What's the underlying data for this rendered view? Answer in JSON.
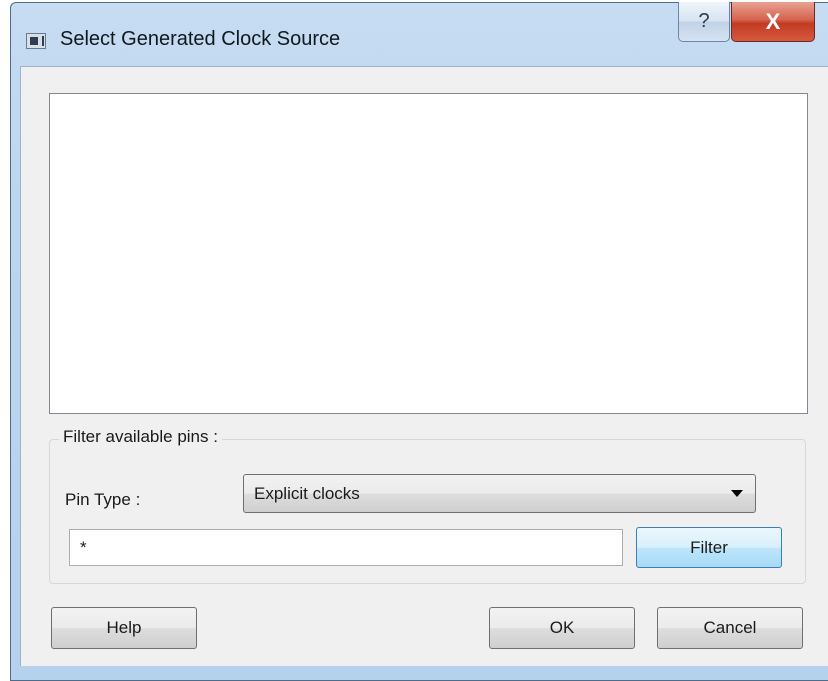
{
  "window": {
    "title": "Select Generated Clock Source",
    "help_glyph": "?",
    "close_glyph": "X"
  },
  "filter_group": {
    "label": "Filter available pins :",
    "pin_type_label": "Pin Type :",
    "pin_type_selected": "Explicit clocks",
    "pattern_value": "*",
    "filter_button": "Filter"
  },
  "buttons": {
    "help": "Help",
    "ok": "OK",
    "cancel": "Cancel"
  },
  "icons": {
    "title": "app-window-icon",
    "dropdown": "chevron-down-icon"
  },
  "colors": {
    "title_bar": "#bcd6ef",
    "close_button": "#c23a22",
    "dialog_face": "#f0f0f0",
    "default_button_border": "#3c7fb1"
  }
}
